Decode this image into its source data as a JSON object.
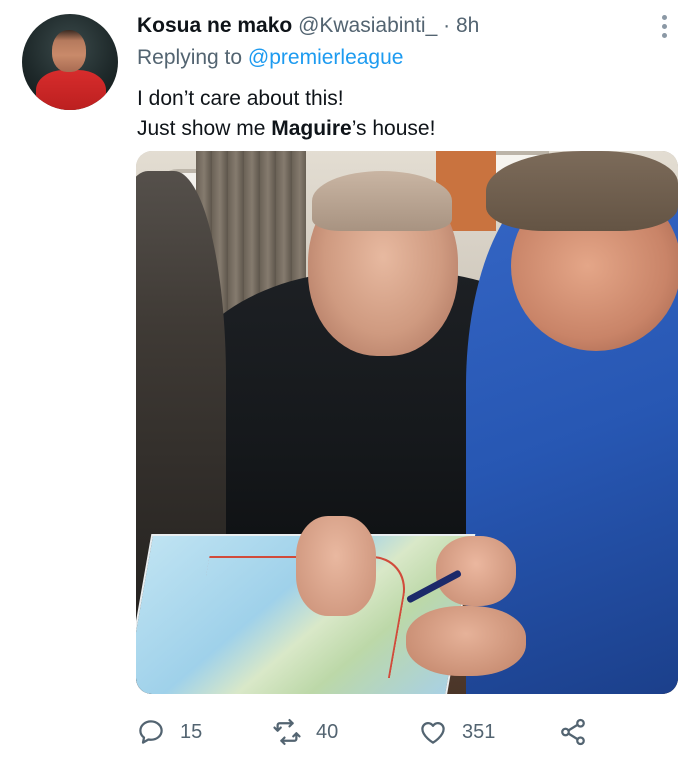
{
  "tweet": {
    "author_name": "Kosua ne mako",
    "author_handle": "@Kwasiabinti_",
    "separator": "·",
    "time": "8h",
    "replying_prefix": "Replying to",
    "replying_to": "@premierleague",
    "text_line1": "I don’t care about this!",
    "text_line2_prefix": "Just show me ",
    "text_line2_bold": "Maguire",
    "text_line2_suffix": "’s house!"
  },
  "stats": {
    "replies": "15",
    "retweets": "40",
    "likes": "351"
  },
  "icons": {
    "more": "more-vertical-icon",
    "reply": "reply-icon",
    "retweet": "retweet-icon",
    "like": "heart-icon",
    "share": "share-icon"
  },
  "colors": {
    "text_primary": "#0f1419",
    "text_secondary": "#536471",
    "link": "#1d9bf0"
  }
}
